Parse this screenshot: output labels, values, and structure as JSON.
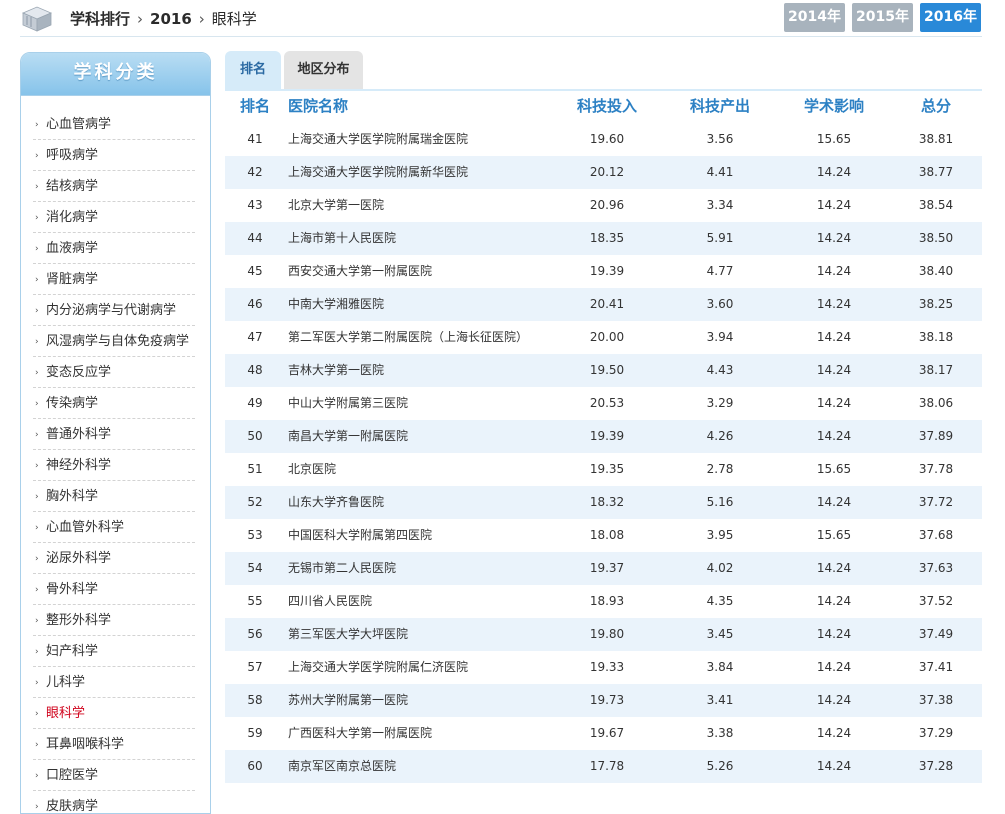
{
  "header": {
    "breadcrumb": [
      "学科排行",
      "2016",
      "眼科学"
    ],
    "year_tabs": [
      {
        "label": "2014年",
        "active": false
      },
      {
        "label": "2015年",
        "active": false
      },
      {
        "label": "2016年",
        "active": true
      }
    ]
  },
  "sidebar": {
    "title": "学科分类",
    "items": [
      "心血管病学",
      "呼吸病学",
      "结核病学",
      "消化病学",
      "血液病学",
      "肾脏病学",
      "内分泌病学与代谢病学",
      "风湿病学与自体免疫病学",
      "变态反应学",
      "传染病学",
      "普通外科学",
      "神经外科学",
      "胸外科学",
      "心血管外科学",
      "泌尿外科学",
      "骨外科学",
      "整形外科学",
      "妇产科学",
      "儿科学",
      "眼科学",
      "耳鼻咽喉科学",
      "口腔医学",
      "皮肤病学"
    ],
    "active_item": "眼科学"
  },
  "content_tabs": [
    "排名",
    "地区分布"
  ],
  "table": {
    "columns": [
      "排名",
      "医院名称",
      "科技投入",
      "科技产出",
      "学术影响",
      "总分"
    ],
    "rows": [
      [
        "41",
        "上海交通大学医学院附属瑞金医院",
        "19.60",
        "3.56",
        "15.65",
        "38.81"
      ],
      [
        "42",
        "上海交通大学医学院附属新华医院",
        "20.12",
        "4.41",
        "14.24",
        "38.77"
      ],
      [
        "43",
        "北京大学第一医院",
        "20.96",
        "3.34",
        "14.24",
        "38.54"
      ],
      [
        "44",
        "上海市第十人民医院",
        "18.35",
        "5.91",
        "14.24",
        "38.50"
      ],
      [
        "45",
        "西安交通大学第一附属医院",
        "19.39",
        "4.77",
        "14.24",
        "38.40"
      ],
      [
        "46",
        "中南大学湘雅医院",
        "20.41",
        "3.60",
        "14.24",
        "38.25"
      ],
      [
        "47",
        "第二军医大学第二附属医院（上海长征医院）",
        "20.00",
        "3.94",
        "14.24",
        "38.18"
      ],
      [
        "48",
        "吉林大学第一医院",
        "19.50",
        "4.43",
        "14.24",
        "38.17"
      ],
      [
        "49",
        "中山大学附属第三医院",
        "20.53",
        "3.29",
        "14.24",
        "38.06"
      ],
      [
        "50",
        "南昌大学第一附属医院",
        "19.39",
        "4.26",
        "14.24",
        "37.89"
      ],
      [
        "51",
        "北京医院",
        "19.35",
        "2.78",
        "15.65",
        "37.78"
      ],
      [
        "52",
        "山东大学齐鲁医院",
        "18.32",
        "5.16",
        "14.24",
        "37.72"
      ],
      [
        "53",
        "中国医科大学附属第四医院",
        "18.08",
        "3.95",
        "15.65",
        "37.68"
      ],
      [
        "54",
        "无锡市第二人民医院",
        "19.37",
        "4.02",
        "14.24",
        "37.63"
      ],
      [
        "55",
        "四川省人民医院",
        "18.93",
        "4.35",
        "14.24",
        "37.52"
      ],
      [
        "56",
        "第三军医大学大坪医院",
        "19.80",
        "3.45",
        "14.24",
        "37.49"
      ],
      [
        "57",
        "上海交通大学医学院附属仁济医院",
        "19.33",
        "3.84",
        "14.24",
        "37.41"
      ],
      [
        "58",
        "苏州大学附属第一医院",
        "19.73",
        "3.41",
        "14.24",
        "37.38"
      ],
      [
        "59",
        "广西医科大学第一附属医院",
        "19.67",
        "3.38",
        "14.24",
        "37.29"
      ],
      [
        "60",
        "南京军区南京总医院",
        "17.78",
        "5.26",
        "14.24",
        "37.28"
      ]
    ]
  }
}
